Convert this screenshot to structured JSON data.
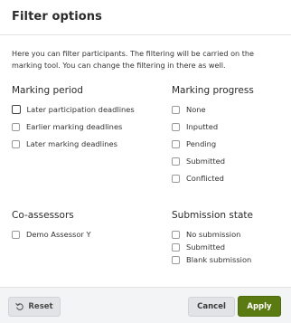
{
  "dialog": {
    "title": "Filter options",
    "intro": "Here you can filter participants. The filtering will be carried on the marking tool. You can change the filtering in there as well."
  },
  "marking_period": {
    "title": "Marking period",
    "options": [
      {
        "label": "Later participation deadlines",
        "checked": false,
        "focused": true
      },
      {
        "label": "Earlier marking deadlines",
        "checked": false
      },
      {
        "label": "Later marking deadlines",
        "checked": false
      }
    ]
  },
  "marking_progress": {
    "title": "Marking progress",
    "options": [
      {
        "label": "None",
        "checked": false
      },
      {
        "label": "Inputted",
        "checked": false
      },
      {
        "label": "Pending",
        "checked": false
      },
      {
        "label": "Submitted",
        "checked": false
      },
      {
        "label": "Conflicted",
        "checked": false
      }
    ]
  },
  "co_assessors": {
    "title": "Co-assessors",
    "options": [
      {
        "label": "Demo Assessor Y",
        "checked": false
      }
    ]
  },
  "submission_state": {
    "title": "Submission state",
    "options": [
      {
        "label": "No submission",
        "checked": false
      },
      {
        "label": "Submitted",
        "checked": false
      },
      {
        "label": "Blank submission",
        "checked": false
      }
    ]
  },
  "footer": {
    "reset_label": "Reset",
    "reset_icon": "rotate-left-icon",
    "cancel_label": "Cancel",
    "apply_label": "Apply"
  },
  "colors": {
    "apply": "#5a7a12",
    "footer_bg": "#f3f4f6",
    "button_grey": "#e2e3e6"
  }
}
